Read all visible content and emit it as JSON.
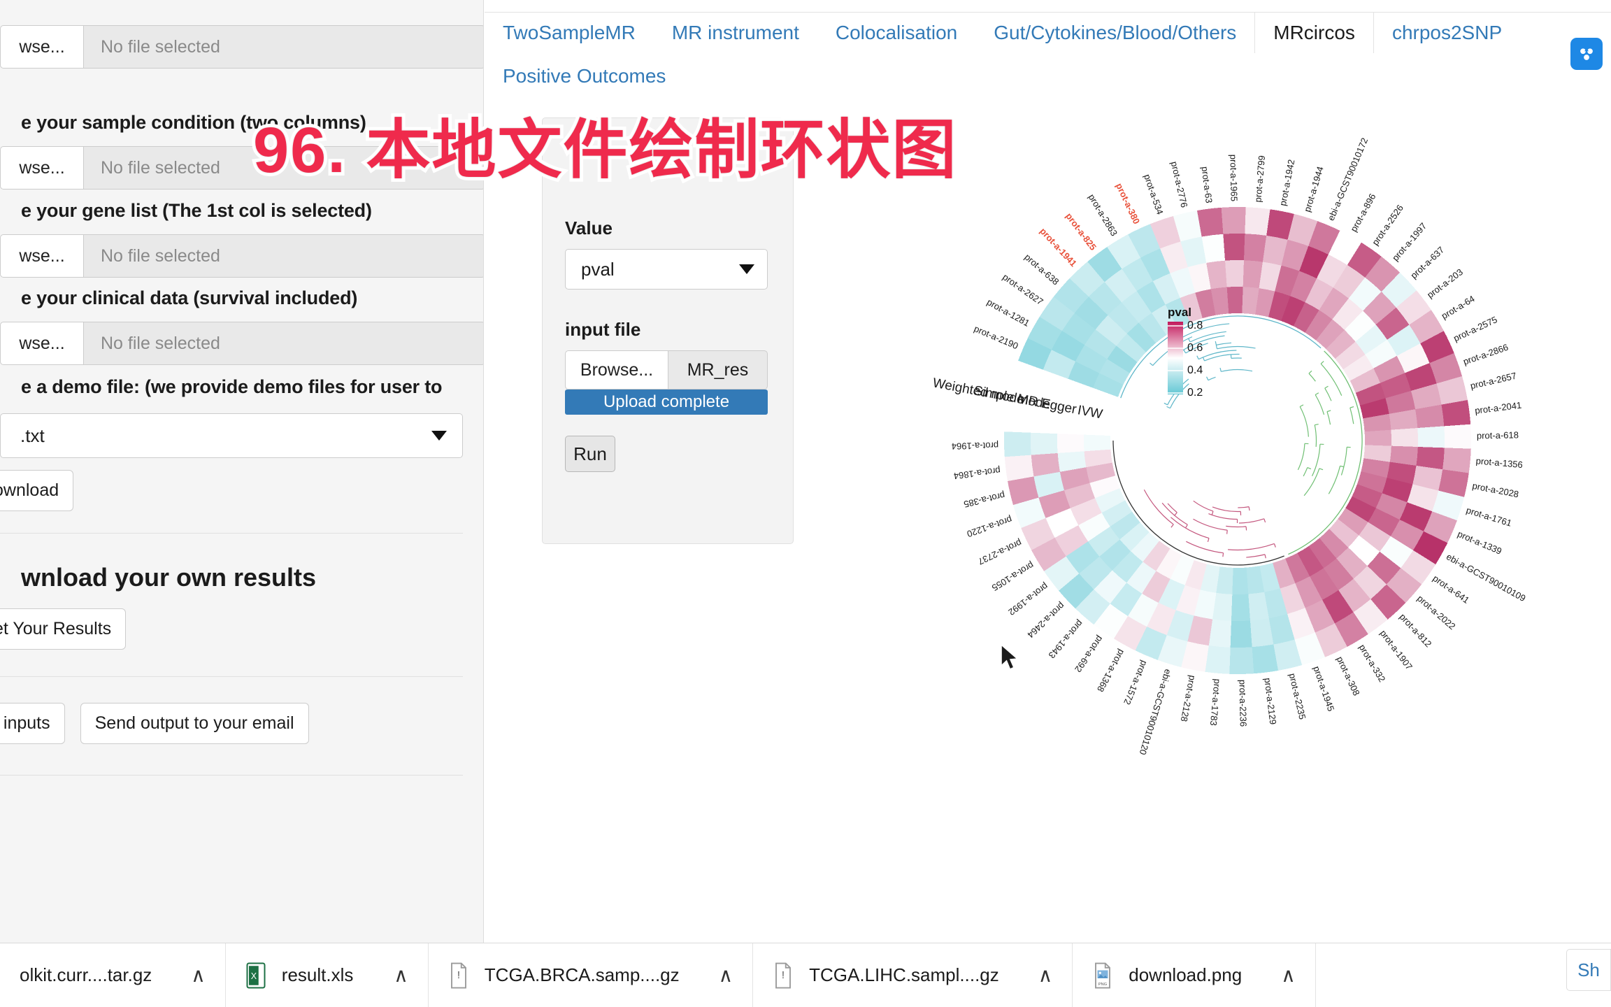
{
  "sidebar": {
    "browse_label": "wse...",
    "no_file": "No file selected",
    "label_sample_condition": "e your sample condition (two columns)",
    "label_gene_list": "e your gene list (The 1st col is selected)",
    "label_clinical": "e your clinical data (survival included)",
    "label_demo": "e a demo file: (we provide demo files for user to",
    "demo_value": ".txt",
    "download_btn": "ownload",
    "heading_results": "wnload your own results",
    "get_results_btn": "et Your Results",
    "reset_btn": "t inputs",
    "email_btn": "Send output to your email"
  },
  "nav": {
    "items": [
      {
        "label": "TwoSampleMR",
        "active": false
      },
      {
        "label": "MR instrument",
        "active": false
      },
      {
        "label": "Colocalisation",
        "active": false
      },
      {
        "label": "Gut/Cytokines/Blood/Others",
        "active": false
      },
      {
        "label": "MRcircos",
        "active": true
      },
      {
        "label": "chrpos2SNP",
        "active": false
      }
    ],
    "second_row": [
      {
        "label": "Positive Outcomes",
        "active": false
      }
    ],
    "brand_icon": "molecule-icon"
  },
  "control_panel": {
    "value_label": "Value",
    "value_selected": "pval",
    "input_file_label": "input file",
    "browse_label": "Browse...",
    "file_name": "MR_res",
    "upload_status": "Upload complete",
    "run_label": "Run"
  },
  "overlay": {
    "title": "96. 本地文件绘制环状图"
  },
  "download_bar": {
    "items": [
      {
        "name": "olkit.curr....tar.gz",
        "icon": "archive-icon",
        "chevron": "∧"
      },
      {
        "name": "result.xls",
        "icon": "excel-icon",
        "chevron": "∧"
      },
      {
        "name": "TCGA.BRCA.samp....gz",
        "icon": "file-icon",
        "chevron": "∧"
      },
      {
        "name": "TCGA.LIHC.sampl....gz",
        "icon": "file-icon",
        "chevron": "∧"
      },
      {
        "name": "download.png",
        "icon": "image-icon",
        "chevron": "∧"
      }
    ],
    "show_all": "Sh"
  },
  "chart_data": {
    "type": "heatmap",
    "title": "MRcircos",
    "legend_title": "pval",
    "legend_ticks": [
      0.8,
      0.6,
      0.4,
      0.2
    ],
    "colors_low": "#62c7d4",
    "colors_mid": "#ffffff",
    "colors_high": "#c2185b",
    "ring_labels": [
      "IVW",
      "MR Egger",
      "Simple mode",
      "Weighted mode"
    ],
    "legend_position": "center",
    "highlighted_color": "#e8513a",
    "categories": [
      "prot-a-2190",
      "prot-a-1281",
      "prot-a-2627",
      "prot-a-638",
      "prot-a-1941",
      "prot-a-825",
      "prot-a-2863",
      "prot-a-380",
      "prot-a-534",
      "prot-a-2776",
      "prot-a-63",
      "prot-a-1965",
      "prot-a-2799",
      "prot-a-1942",
      "prot-a-1944",
      "ebi-a-GCST90010172",
      "prot-a-896",
      "prot-a-2526",
      "prot-a-1997",
      "prot-a-637",
      "prot-a-203",
      "prot-a-64",
      "prot-a-2575",
      "prot-a-2866",
      "prot-a-2657",
      "prot-a-2041",
      "prot-a-618",
      "prot-a-1356",
      "prot-a-2028",
      "prot-a-1761",
      "prot-a-1339",
      "ebi-a-GCST90010109",
      "prot-a-641",
      "prot-a-2022",
      "prot-a-812",
      "prot-a-1907",
      "prot-a-332",
      "prot-a-308",
      "prot-a-1945",
      "prot-a-2235",
      "prot-a-2129",
      "prot-a-2236",
      "prot-a-1783",
      "prot-a-2128",
      "ebi-a-GCST90010120",
      "prot-a-1572",
      "prot-a-1368",
      "prot-a-692",
      "prot-a-1943",
      "prot-a-2464",
      "prot-a-1992",
      "prot-a-1055",
      "prot-a-2737",
      "prot-a-1220",
      "prot-a-385",
      "prot-a-1864",
      "prot-a-1964"
    ],
    "highlighted_categories": [
      "prot-a-1941",
      "prot-a-825",
      "prot-a-380"
    ],
    "series": [
      {
        "name": "IVW",
        "values": [
          0.22,
          0.25,
          0.18,
          0.3,
          0.21,
          0.28,
          0.35,
          0.26,
          0.62,
          0.78,
          0.74,
          0.83,
          0.68,
          0.72,
          0.88,
          0.91,
          0.84,
          0.76,
          0.7,
          0.66,
          0.58,
          0.54,
          0.64,
          0.87,
          0.92,
          0.73,
          0.69,
          0.61,
          0.77,
          0.8,
          0.85,
          0.9,
          0.71,
          0.63,
          0.75,
          0.82,
          0.86,
          0.79,
          0.67,
          0.31,
          0.27,
          0.24,
          0.33,
          0.41,
          0.55,
          0.48,
          0.52,
          0.59,
          0.44,
          0.38,
          0.29,
          0.36,
          0.43,
          0.51,
          0.65,
          0.57,
          0.46
        ]
      },
      {
        "name": "MR Egger",
        "values": [
          0.19,
          0.23,
          0.26,
          0.34,
          0.29,
          0.32,
          0.24,
          0.37,
          0.45,
          0.52,
          0.66,
          0.6,
          0.71,
          0.58,
          0.81,
          0.77,
          0.63,
          0.69,
          0.55,
          0.49,
          0.42,
          0.47,
          0.73,
          0.85,
          0.79,
          0.68,
          0.56,
          0.74,
          0.88,
          0.91,
          0.76,
          0.83,
          0.62,
          0.5,
          0.67,
          0.78,
          0.8,
          0.72,
          0.59,
          0.28,
          0.35,
          0.21,
          0.4,
          0.46,
          0.53,
          0.39,
          0.61,
          0.44,
          0.3,
          0.25,
          0.33,
          0.48,
          0.57,
          0.64,
          0.7,
          0.43,
          0.51
        ]
      },
      {
        "name": "Simple mode",
        "values": [
          0.31,
          0.17,
          0.22,
          0.2,
          0.27,
          0.36,
          0.3,
          0.23,
          0.54,
          0.41,
          0.49,
          0.87,
          0.77,
          0.65,
          0.72,
          0.93,
          0.58,
          0.61,
          0.46,
          0.7,
          0.83,
          0.39,
          0.52,
          0.9,
          0.68,
          0.75,
          0.44,
          0.86,
          0.63,
          0.56,
          0.92,
          0.74,
          0.48,
          0.81,
          0.59,
          0.66,
          0.89,
          0.69,
          0.53,
          0.26,
          0.34,
          0.18,
          0.42,
          0.62,
          0.37,
          0.55,
          0.47,
          0.32,
          0.45,
          0.29,
          0.24,
          0.6,
          0.5,
          0.71,
          0.38,
          0.67,
          0.4
        ]
      },
      {
        "name": "Weighted mode",
        "values": [
          0.16,
          0.21,
          0.28,
          0.25,
          0.33,
          0.19,
          0.38,
          0.29,
          0.6,
          0.47,
          0.82,
          0.71,
          0.55,
          0.89,
          0.64,
          0.79,
          0.5,
          0.85,
          0.73,
          0.42,
          0.57,
          0.66,
          0.91,
          0.76,
          0.62,
          0.88,
          0.51,
          0.69,
          0.8,
          0.45,
          0.7,
          0.94,
          0.58,
          0.67,
          0.83,
          0.54,
          0.77,
          0.61,
          0.48,
          0.35,
          0.22,
          0.27,
          0.39,
          0.52,
          0.43,
          0.31,
          0.56,
          0.49,
          0.36,
          0.2,
          0.41,
          0.65,
          0.59,
          0.46,
          0.72,
          0.53,
          0.34
        ]
      }
    ]
  }
}
